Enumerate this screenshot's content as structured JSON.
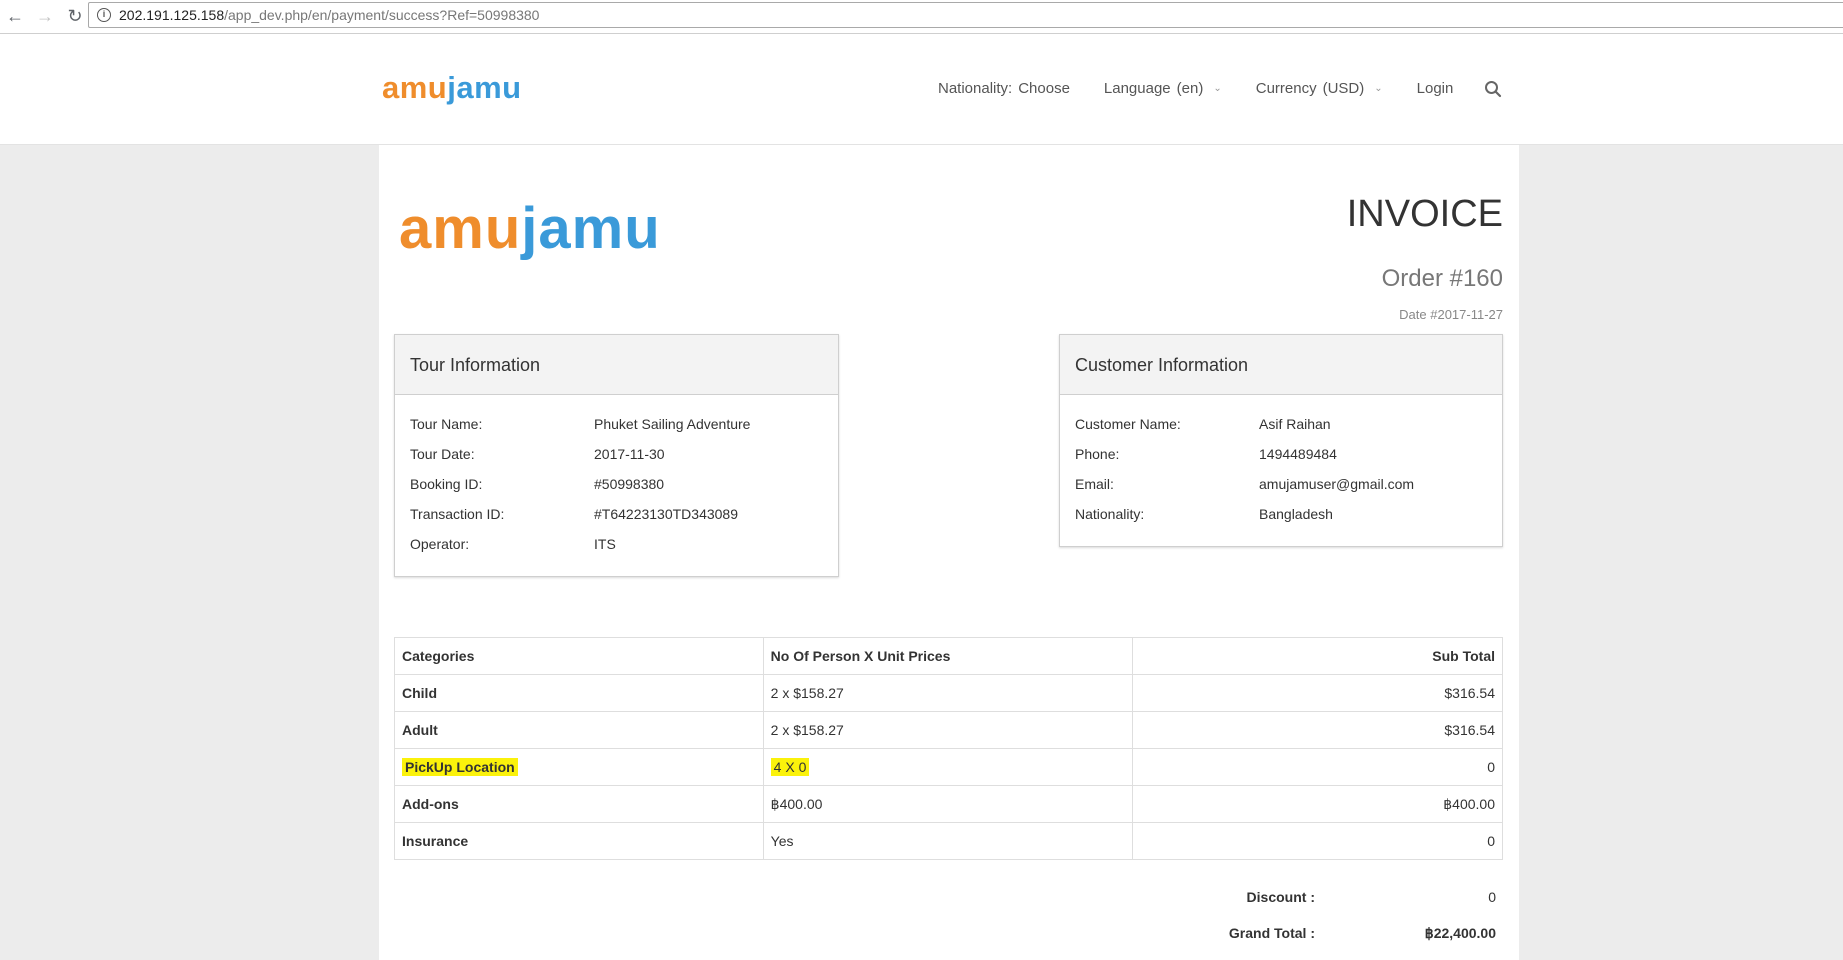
{
  "browser": {
    "url_host": "202.191.125.158",
    "url_path": "/app_dev.php/en/payment/success?Ref=50998380"
  },
  "header": {
    "logo_part1": "amu",
    "logo_part2": "jamu",
    "nav": {
      "nationality_label": "Nationality:",
      "nationality_value": "Choose",
      "language_label": "Language",
      "language_value": "(en)",
      "currency_label": "Currency",
      "currency_value": "(USD)",
      "login": "Login"
    }
  },
  "invoice": {
    "logo_part1": "amu",
    "logo_part2": "jamu",
    "title": "INVOICE",
    "order": "Order #160",
    "date": "Date #2017-11-27",
    "tour": {
      "heading": "Tour Information",
      "rows": [
        {
          "k": "Tour Name:",
          "v": "Phuket Sailing Adventure"
        },
        {
          "k": "Tour Date:",
          "v": "2017-11-30"
        },
        {
          "k": "Booking ID:",
          "v": "#50998380"
        },
        {
          "k": "Transaction ID:",
          "v": "#T64223130TD343089"
        },
        {
          "k": "Operator:",
          "v": "ITS"
        }
      ]
    },
    "customer": {
      "heading": "Customer Information",
      "rows": [
        {
          "k": "Customer Name:",
          "v": "Asif Raihan"
        },
        {
          "k": "Phone:",
          "v": "1494489484"
        },
        {
          "k": "Email:",
          "v": "amujamuser@gmail.com"
        },
        {
          "k": "Nationality:",
          "v": "Bangladesh"
        }
      ]
    },
    "table": {
      "headers": [
        "Categories",
        "No Of Person X Unit Prices",
        "Sub Total"
      ],
      "rows": [
        {
          "cat": "Child",
          "qty": "2 x $158.27",
          "sub": "$316.54"
        },
        {
          "cat": "Adult",
          "qty": "2 x $158.27",
          "sub": "$316.54"
        },
        {
          "cat": "PickUp Location",
          "qty": "4 X 0",
          "sub": "0"
        },
        {
          "cat": "Add-ons",
          "qty": "฿400.00",
          "sub": "฿400.00"
        },
        {
          "cat": "Insurance",
          "qty": "Yes",
          "sub": "0"
        }
      ]
    },
    "totals": {
      "discount_label": "Discount :",
      "discount_value": "0",
      "grand_label": "Grand Total :",
      "grand_value": "฿22,400.00"
    }
  },
  "colors": {
    "logo_orange": "#ef8d2c",
    "logo_blue": "#3a9ad9",
    "highlight": "#fbf20b"
  }
}
